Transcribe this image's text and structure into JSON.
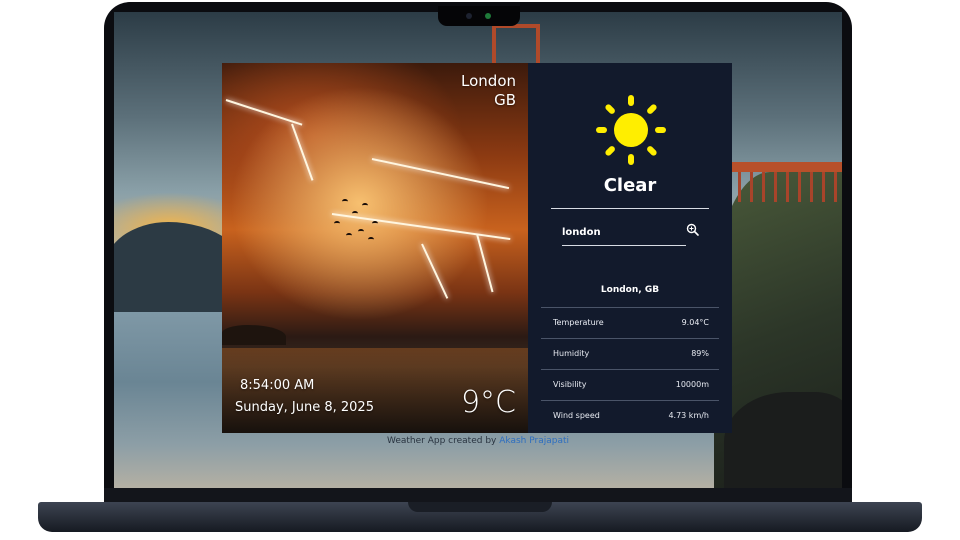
{
  "app": {
    "hero": {
      "city": "London",
      "country": "GB",
      "time": "8:54:00 AM",
      "date": "Sunday, June 8, 2025",
      "temperature": "9°C"
    },
    "panel": {
      "icon": "sun-icon",
      "condition": "Clear",
      "search": {
        "value": "london",
        "icon": "search-zoom-icon"
      },
      "location": "London, GB",
      "stats": [
        {
          "label": "Temperature",
          "value": "9.04°C"
        },
        {
          "label": "Humidity",
          "value": "89%"
        },
        {
          "label": "Visibility",
          "value": "10000m"
        },
        {
          "label": "Wind speed",
          "value": "4.73 km/h"
        }
      ]
    },
    "credit": {
      "prefix": "Weather App created by",
      "author": "Akash Prajapati"
    }
  },
  "colors": {
    "panel_bg": "#121a2c",
    "sun": "#ffee00",
    "link": "#2f6fc0"
  }
}
